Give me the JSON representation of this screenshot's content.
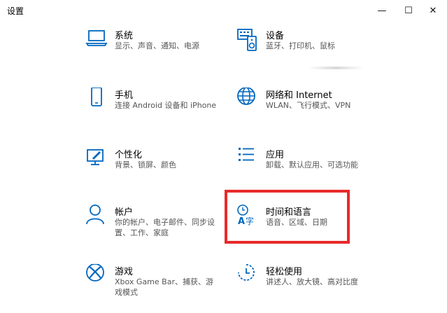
{
  "window": {
    "title": "设置",
    "accent": "#0067c0",
    "highlight_color": "#e82a2a"
  },
  "controls": {
    "minimize": "—",
    "maximize": "☐",
    "close": "✕"
  },
  "items": [
    {
      "label": "系统",
      "desc": "显示、声音、通知、电源",
      "icon": "laptop-icon"
    },
    {
      "label": "设备",
      "desc": "蓝牙、打印机、鼠标",
      "icon": "keyboard-speaker-icon"
    },
    {
      "label": "手机",
      "desc": "连接 Android 设备和 iPhone",
      "icon": "phone-icon"
    },
    {
      "label": "网络和 Internet",
      "desc": "WLAN、飞行模式、VPN",
      "icon": "globe-icon"
    },
    {
      "label": "个性化",
      "desc": "背景、锁屏、颜色",
      "icon": "paintbrush-icon"
    },
    {
      "label": "应用",
      "desc": "卸载、默认应用、可选功能",
      "icon": "apps-list-icon"
    },
    {
      "label": "帐户",
      "desc": "你的帐户、电子邮件、同步设置、工作、家庭",
      "icon": "person-icon"
    },
    {
      "label": "时间和语言",
      "desc": "语音、区域、日期",
      "icon": "time-language-icon"
    },
    {
      "label": "游戏",
      "desc": "Xbox Game Bar、捕获、游戏模式",
      "icon": "xbox-icon"
    },
    {
      "label": "轻松使用",
      "desc": "讲述人、放大镜、高对比度",
      "icon": "ease-of-access-icon"
    }
  ]
}
